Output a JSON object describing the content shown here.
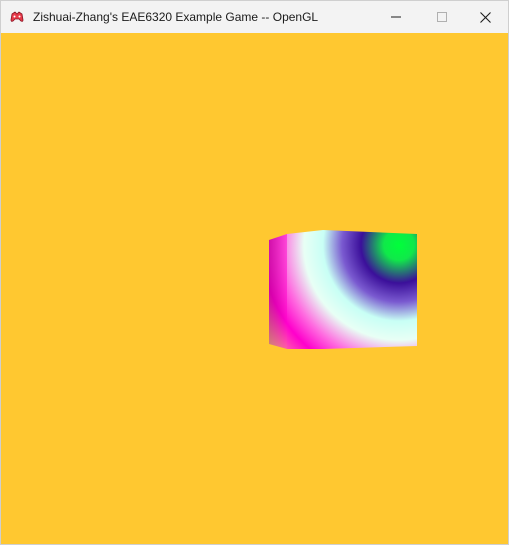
{
  "window": {
    "title": "Zishuai-Zhang's EAE6320 Example Game -- OpenGL",
    "app_icon": "game-controller-icon",
    "controls": {
      "minimize_icon": "minimize-icon",
      "maximize_icon": "maximize-icon",
      "close_icon": "close-icon"
    }
  },
  "scene": {
    "clear_color": "#ffc830",
    "objects": [
      {
        "name": "cube",
        "kind": "gradient-cube",
        "colors": [
          "#00ff3a",
          "#3b0f9a",
          "#c8fff5",
          "#ff00cc",
          "#d7ff3a"
        ]
      }
    ]
  }
}
